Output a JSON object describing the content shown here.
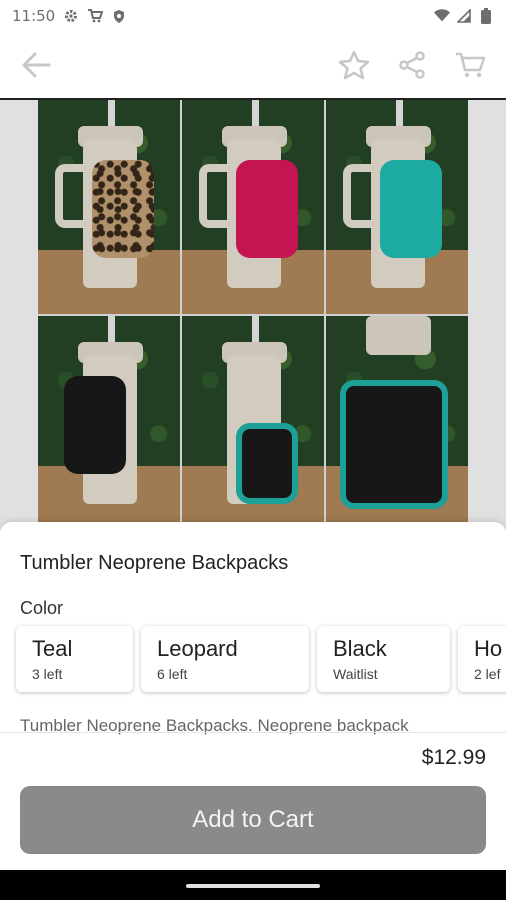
{
  "status_bar": {
    "time": "11:50",
    "icons": [
      "settings-icon",
      "cart-icon",
      "shield-icon",
      "wifi-icon",
      "signal-icon",
      "battery-icon"
    ]
  },
  "app_bar": {
    "icons": [
      "back-arrow-icon",
      "star-icon",
      "share-icon",
      "cart-icon"
    ]
  },
  "product": {
    "title": "Tumbler Neoprene Backpacks",
    "color_label": "Color",
    "options": [
      {
        "name": "Teal",
        "availability": "3 left"
      },
      {
        "name": "Leopard",
        "availability": "6 left"
      },
      {
        "name": "Black",
        "availability": "Waitlist"
      },
      {
        "name": "Ho",
        "availability": "2 lef"
      }
    ],
    "description": "Tumbler Neoprene Backpacks. Neoprene backpack",
    "price": "$12.99",
    "add_to_cart_label": "Add to Cart"
  },
  "colors": {
    "button_disabled": "#8a8a8a",
    "text_primary": "#222222"
  }
}
